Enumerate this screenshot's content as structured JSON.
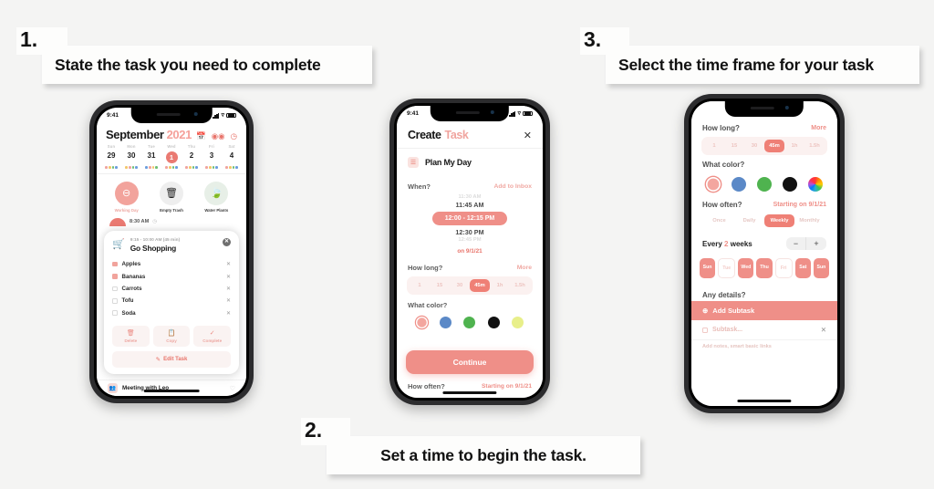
{
  "callouts": [
    {
      "number": "1.",
      "text": "State the task you need to complete"
    },
    {
      "number": "2.",
      "text": "Set a time to begin the task."
    },
    {
      "number": "3.",
      "text": "Select the time frame for your task"
    }
  ],
  "phone1": {
    "status": {
      "time": "9:41"
    },
    "calendar": {
      "month": "September",
      "year": "2021",
      "icons": [
        "calendar-icon",
        "binoculars-icon",
        "clock-icon"
      ],
      "weekdays": [
        "Sun",
        "Mon",
        "Tue",
        "Wed",
        "Thu",
        "Fri",
        "Sat"
      ],
      "dates": [
        "29",
        "30",
        "31",
        "1",
        "2",
        "3",
        "4"
      ],
      "selected_index": 3
    },
    "quick_actions": [
      {
        "label": "Working Day",
        "icon": "minus-circle-icon",
        "color": "#ef8f88",
        "bg": "#f2a39c"
      },
      {
        "label": "Empty Trash",
        "icon": "trash-icon",
        "color": "#1e1e1e",
        "bg": "#eeeeee"
      },
      {
        "label": "Water Plants",
        "icon": "leaf-icon",
        "color": "#4caf50",
        "bg": "#e7efe7"
      }
    ],
    "next_event": {
      "time": "8:30 AM",
      "clock_icon": "clock-icon"
    },
    "task_card": {
      "icon": "shopping-cart-icon",
      "time_range": "9:15 - 10:00 AM (45 min)",
      "title": "Go Shopping",
      "close_icon": "close-icon",
      "items": [
        {
          "label": "Apples",
          "checked": true
        },
        {
          "label": "Bananas",
          "checked": true
        },
        {
          "label": "Carrots",
          "checked": false
        },
        {
          "label": "Tofu",
          "checked": false
        },
        {
          "label": "Soda",
          "checked": false
        }
      ],
      "actions": [
        {
          "label": "Delete",
          "icon": "trash-icon"
        },
        {
          "label": "Copy",
          "icon": "copy-icon"
        },
        {
          "label": "Complete",
          "icon": "check-circle-icon"
        }
      ],
      "edit": {
        "label": "Edit Task",
        "icon": "pencil-circle-icon"
      }
    },
    "bottom_event": {
      "title": "Meeting with Leo",
      "avatar_icon": "people-icon",
      "heart_icon": "heart-icon"
    }
  },
  "phone2": {
    "status": {
      "time": "9:41"
    },
    "header": {
      "title": "Create",
      "title_accent": "Task",
      "close_icon": "close-icon"
    },
    "task": {
      "name": "Plan My Day",
      "icon": "note-icon"
    },
    "when": {
      "question": "When?",
      "action": "Add to Inbox"
    },
    "time_wheel": {
      "above_far": "11:30 AM",
      "above_near": "11:45 AM",
      "selected": "12:00 - 12:15 PM",
      "below_near": "12:30 PM",
      "below_far": "12:45 PM"
    },
    "on_date": {
      "prefix": "on",
      "date": "9/1/21"
    },
    "how_long": {
      "question": "How long?",
      "action": "More",
      "options": [
        "1",
        "15",
        "30",
        "45m",
        "1h",
        "1.5h"
      ],
      "selected": "45m"
    },
    "what_color": {
      "question": "What color?",
      "swatches": [
        "#f3a69f",
        "#5b89c7",
        "#4fb34f",
        "#111111",
        "#e8ef8a"
      ]
    },
    "continue_button": "Continue",
    "how_often": {
      "question": "How often?",
      "action": "Starting on 9/1/21"
    }
  },
  "phone3": {
    "how_long": {
      "question": "How long?",
      "action": "More",
      "options": [
        "1",
        "15",
        "30",
        "45m",
        "1h",
        "1.5h"
      ],
      "selected": "45m"
    },
    "what_color": {
      "question": "What color?",
      "swatches": [
        "#f3a69f",
        "#5b89c7",
        "#4fb34f",
        "#111111",
        "rainbow"
      ]
    },
    "how_often": {
      "question": "How often?",
      "action": "Starting on 9/1/21",
      "options": [
        "Once",
        "Daily",
        "Weekly",
        "Monthly"
      ],
      "selected": "Weekly"
    },
    "every": {
      "prefix": "Every",
      "count": "2",
      "unit": "weeks",
      "minus": "−",
      "plus": "+"
    },
    "days": [
      {
        "label": "Sun",
        "on": true
      },
      {
        "label": "Tue",
        "on": false
      },
      {
        "label": "Wed",
        "on": true
      },
      {
        "label": "Thu",
        "on": true
      },
      {
        "label": "Fri",
        "on": false
      },
      {
        "label": "Sat",
        "on": true
      },
      {
        "label": "Sun",
        "on": true
      }
    ],
    "details": {
      "question": "Any details?"
    },
    "add_subtask": {
      "label": "Add Subtask",
      "icon": "plus-circle-icon"
    },
    "subtask_row": {
      "placeholder": "Subtask...",
      "checkbox_icon": "checkbox-icon",
      "close_icon": "close-icon"
    },
    "note": "Add notes, smart basic links"
  },
  "colors": {
    "accent": "#ef8f88",
    "accent_light": "#f3a69f",
    "page_bg": "#f4f4f3"
  }
}
